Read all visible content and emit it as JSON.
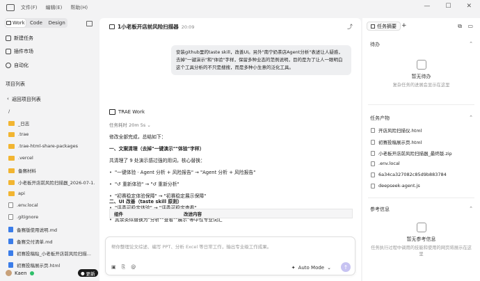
{
  "menu": {
    "file": "文件(F)",
    "edit": "编辑(E)",
    "help": "帮助(H)"
  },
  "window_controls": {
    "minimize": "—",
    "maximize": "☐",
    "close": "✕"
  },
  "sidebar": {
    "mode_tabs": [
      {
        "label": "Work",
        "active": true
      },
      {
        "label": "Code",
        "active": false
      },
      {
        "label": "Design",
        "active": false
      }
    ],
    "nav": [
      {
        "label": "新建任务"
      },
      {
        "label": "插件市场"
      },
      {
        "label": "自动化"
      }
    ],
    "project_list_label": "项目列表",
    "back_label": "返回项目列表",
    "files": [
      {
        "name": "/",
        "type": "none"
      },
      {
        "name": "_日志",
        "type": "folder"
      },
      {
        "name": ".trae",
        "type": "folder"
      },
      {
        "name": ".trae-html-share-packages",
        "type": "folder"
      },
      {
        "name": ".vercel",
        "type": "folder"
      },
      {
        "name": "备赛材料",
        "type": "folder"
      },
      {
        "name": "小老板开店前风险扫描器_2026-07-1...",
        "type": "folder"
      },
      {
        "name": "api",
        "type": "folder"
      },
      {
        "name": ".env.local",
        "type": "doc"
      },
      {
        "name": ".gitignore",
        "type": "doc"
      },
      {
        "name": "备赛版使用说明.md",
        "type": "blue"
      },
      {
        "name": "备赛交付清单.md",
        "type": "blue"
      },
      {
        "name": "初赛投稿贴_小老板开店前风险扫描...",
        "type": "blue"
      },
      {
        "name": "初赛投稿展示页.html",
        "type": "blue"
      }
    ],
    "user_name": "Kaen",
    "update_label": "更新"
  },
  "main": {
    "title": "1小老板开店前风险扫描器",
    "title_time": "20:09",
    "user_message": "安装github里的taste skill，改善UI。另外\"南宁奶茶店Agent分析\"表述让人疑惑，去掉\"一键演示\"和\"体验\"字样，保留多种业态的范例说明，目的是为了让人一眼明白这个工具分析的不只是搜搜，而是多种小生意的泛化工具。",
    "agent_name": "TRAE Work",
    "task_time": "任务耗时 20m 5s",
    "answer_lines": [
      {
        "text": "修改全部完成，总结如下：",
        "style": "p"
      },
      {
        "text": "一、文案清理（去掉\"一键演示\"\"体验\"字样）",
        "style": "h"
      },
      {
        "text": "共清理了 9 处演示感过强的用词，核心替换：",
        "style": "p"
      },
      {
        "text": "\"一键体验 · Agent 分析 + 风险报告\" → \"Agent 分析 + 风险报告\"",
        "style": "b"
      },
      {
        "text": "\"↺ 重新体验\" → \"↺ 重新分析\"",
        "style": "b"
      },
      {
        "text": "\"初赛稳定体验保障\" → \"初赛稳定展示保障\"",
        "style": "b"
      },
      {
        "text": "\"评委可稳定体验\" → \"评委可稳定查看\"",
        "style": "b"
      },
      {
        "text": "其余类似替换为\"分析\"\"查看\"\"展示\"等中性专业词汇",
        "style": "b"
      },
      {
        "text": "二、UI 改善（taste skill 原则）",
        "style": "h"
      }
    ],
    "table_headers": [
      "组件",
      "改进内容"
    ],
    "composer": {
      "placeholder": "帮你整理论文综述、编写 PPT、分析 Excel 等日常工作，输出专业级工作成果。",
      "mode": "Auto Mode",
      "send_icon": "↑"
    }
  },
  "right_panel": {
    "tab_label": "任务摘要",
    "todo": {
      "label": "待办",
      "empty_title": "暂无待办",
      "empty_sub": "复杂任务的进展会显示在这里"
    },
    "artifacts": {
      "label": "任务产物",
      "items": [
        {
          "name": "开店风险扫描仪.html",
          "type": "doc"
        },
        {
          "name": "初赛投稿展示页.html",
          "type": "doc"
        },
        {
          "name": "小老板开店前风险扫描器_最终版.zip",
          "type": "doc"
        },
        {
          "name": ".env.local",
          "type": "doc"
        },
        {
          "name": "6a34ca327082c85d9b883784",
          "type": "doc"
        },
        {
          "name": "deepseek-agent.js",
          "type": "doc"
        }
      ]
    },
    "references": {
      "label": "参考信息",
      "empty_title": "暂无参考信息",
      "empty_sub": "任务执行过程中调用的技能和使用的网页将展示在这里"
    }
  }
}
